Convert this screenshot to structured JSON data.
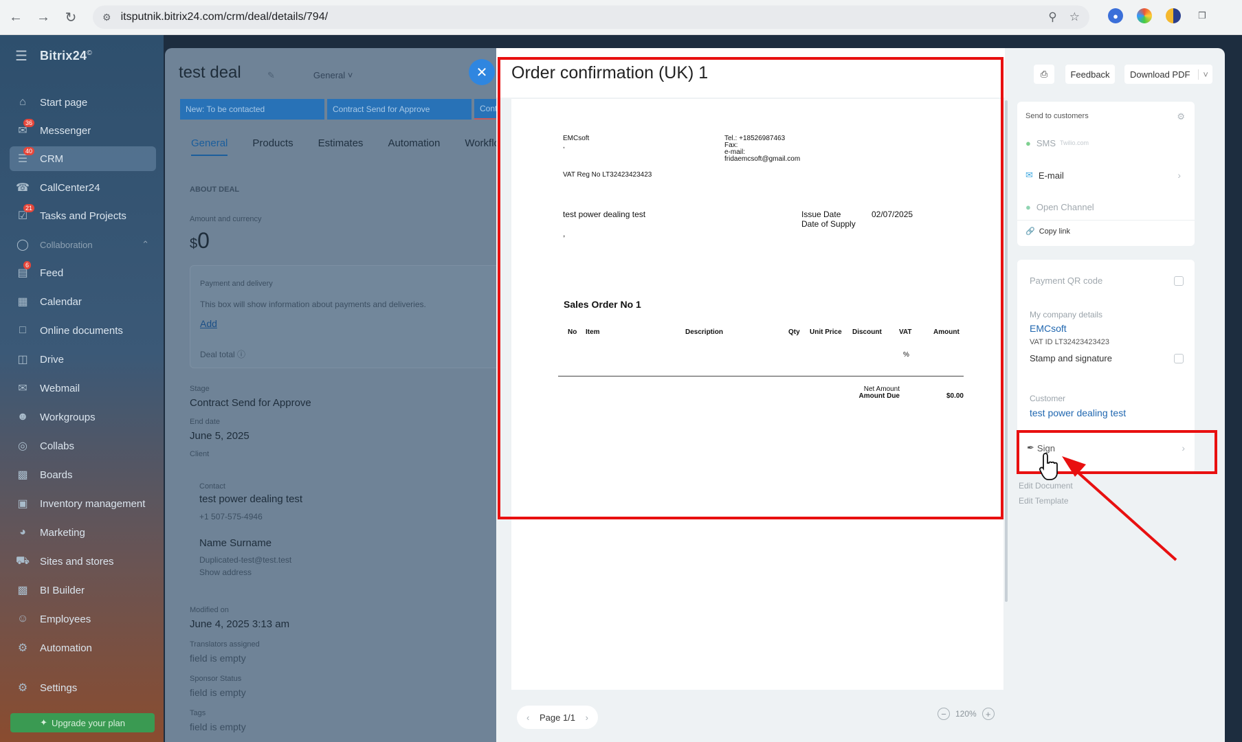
{
  "browser": {
    "url": "itsputnik.bitrix24.com/crm/deal/details/794/"
  },
  "sidebar": {
    "brand": "Bitrix24",
    "brand_mark": "©",
    "items": [
      {
        "label": "Start page",
        "icon": "home-icon"
      },
      {
        "label": "Messenger",
        "icon": "chat-icon",
        "badge": "36"
      },
      {
        "label": "CRM",
        "icon": "crm-icon",
        "badge": "40"
      },
      {
        "label": "CallCenter24",
        "icon": "phone-icon"
      },
      {
        "label": "Tasks and Projects",
        "icon": "tasks-icon",
        "badge": "21"
      },
      {
        "label": "Collaboration",
        "icon": "collab-icon"
      },
      {
        "label": "Feed",
        "icon": "feed-icon",
        "badge": "6"
      },
      {
        "label": "Calendar",
        "icon": "calendar-icon"
      },
      {
        "label": "Online documents",
        "icon": "document-icon"
      },
      {
        "label": "Drive",
        "icon": "drive-icon"
      },
      {
        "label": "Webmail",
        "icon": "mail-icon"
      },
      {
        "label": "Workgroups",
        "icon": "group-icon"
      },
      {
        "label": "Collabs",
        "icon": "collabs-icon"
      },
      {
        "label": "Boards",
        "icon": "board-icon"
      },
      {
        "label": "Inventory management",
        "icon": "inventory-icon"
      },
      {
        "label": "Marketing",
        "icon": "marketing-icon"
      },
      {
        "label": "Sites and stores",
        "icon": "cart-icon"
      },
      {
        "label": "BI Builder",
        "icon": "chart-icon"
      },
      {
        "label": "Employees",
        "icon": "employees-icon"
      },
      {
        "label": "Automation",
        "icon": "automation-icon"
      },
      {
        "label": "Settings",
        "icon": "gear-icon"
      }
    ],
    "upgrade_label": "Upgrade your plan"
  },
  "deal": {
    "title": "test deal",
    "category": "General",
    "stages": [
      "New: To be contacted",
      "Contract Send for Approve",
      "Cont"
    ],
    "tabs": [
      "General",
      "Products",
      "Estimates",
      "Automation",
      "Workflow"
    ],
    "section_title": "ABOUT DEAL",
    "amount_label": "Amount and currency",
    "currency": "$",
    "amount": "0",
    "payment_title": "Payment and delivery",
    "payment_text": "This box will show information about payments and deliveries.",
    "add_label": "Add",
    "deal_total_label": "Deal total",
    "stage_label": "Stage",
    "stage_value": "Contract Send for Approve",
    "end_date_label": "End date",
    "end_date_value": "June 5, 2025",
    "client_label": "Client",
    "contact_label": "Contact",
    "contact_name": "test power dealing test",
    "contact_phone": "+1 507-575-4946",
    "contact2_name": "Name Surname",
    "contact2_email": "Duplicated-test@test.test",
    "show_address": "Show address",
    "modified_label": "Modified on",
    "modified_value": "June 4, 2025 3:13 am",
    "translators_label": "Translators assigned",
    "field_empty": "field is empty",
    "sponsor_label": "Sponsor Status",
    "tags_label": "Tags"
  },
  "document": {
    "title": "Order confirmation (UK) 1",
    "company": "EMCsoft",
    "company_sub": ",",
    "tel": "Tel.: +18526987463",
    "fax": "Fax:",
    "email_label": "e-mail:",
    "email": "fridaemcsoft@gmail.com",
    "vat_reg": "VAT Reg No LT32423423423",
    "customer": "test power dealing test",
    "customer_sub": ",",
    "issue_date_label": "Issue Date",
    "issue_date": "02/07/2025",
    "supply_label": "Date of Supply",
    "order_heading": "Sales Order No 1",
    "columns": [
      "No",
      "Item",
      "Description",
      "Qty",
      "Unit Price",
      "Discount",
      "VAT",
      "Amount"
    ],
    "vat_pct": "%",
    "net_amount_label": "Net Amount",
    "amount_due_label": "Amount Due",
    "amount_due": "$0.00",
    "page_label": "Page 1/1",
    "zoom_level": "120%"
  },
  "right_panel": {
    "feedback_label": "Feedback",
    "download_label": "Download PDF",
    "send_title": "Send to customers",
    "sms_label": "SMS",
    "sms_provider": "Twilio.com",
    "email_label": "E-mail",
    "open_channel_label": "Open Channel",
    "copy_link_label": "Copy link",
    "qr_label": "Payment QR code",
    "company_details_label": "My company details",
    "company_name": "EMCsoft",
    "vat_id": "VAT ID LT32423423423",
    "stamp_label": "Stamp and signature",
    "customer_label": "Customer",
    "customer_name": "test power dealing test",
    "sign_label": "Sign",
    "edit_document": "Edit Document",
    "edit_template": "Edit Template"
  },
  "annotation_colors": {
    "highlight": "#e81010"
  }
}
